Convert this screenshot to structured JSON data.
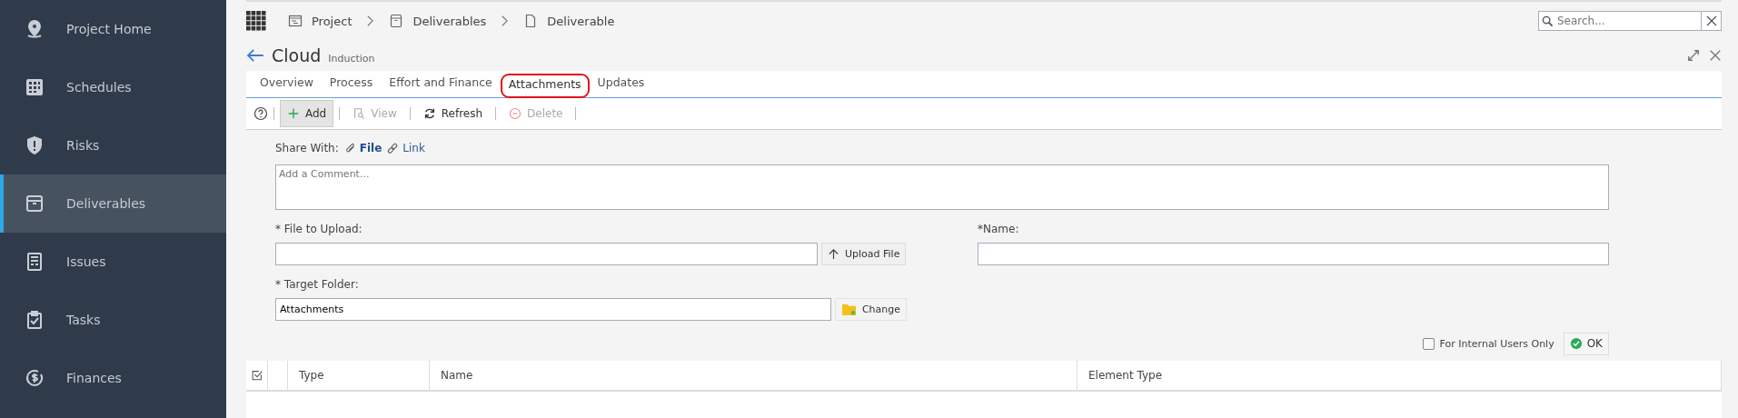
{
  "sidebar": {
    "items": [
      {
        "label": "Project Home",
        "kind": "pin",
        "selected": false
      },
      {
        "label": "Schedules",
        "kind": "grid",
        "selected": false
      },
      {
        "label": "Risks",
        "kind": "shield",
        "selected": false
      },
      {
        "label": "Deliverables",
        "kind": "box",
        "selected": true
      },
      {
        "label": "Issues",
        "kind": "doc",
        "selected": false
      },
      {
        "label": "Tasks",
        "kind": "clipboard",
        "selected": false
      },
      {
        "label": "Finances",
        "kind": "money",
        "selected": false
      }
    ]
  },
  "breadcrumb": [
    {
      "label": "Project",
      "kind": "project"
    },
    {
      "label": "Deliverables",
      "kind": "box"
    },
    {
      "label": "Deliverable",
      "kind": "page"
    }
  ],
  "search": {
    "placeholder": "Search..."
  },
  "header": {
    "title": "Cloud",
    "subtitle": "Induction"
  },
  "tabs": [
    {
      "label": "Overview",
      "selected": false
    },
    {
      "label": "Process",
      "selected": false
    },
    {
      "label": "Effort and Finance",
      "selected": false
    },
    {
      "label": "Attachments",
      "selected": true
    },
    {
      "label": "Updates",
      "selected": false
    }
  ],
  "toolbar": [
    {
      "label": "Add",
      "kind": "plus",
      "disabled": false,
      "pressed": true
    },
    {
      "label": "View",
      "kind": "view",
      "disabled": true,
      "pressed": false
    },
    {
      "label": "Refresh",
      "kind": "refresh",
      "disabled": false,
      "pressed": false
    },
    {
      "label": "Delete",
      "kind": "delete",
      "disabled": true,
      "pressed": false
    }
  ],
  "share": {
    "label": "Share With:",
    "options": [
      {
        "label": "File",
        "kind": "clip",
        "selected": true
      },
      {
        "label": "Link",
        "kind": "link",
        "selected": false
      }
    ]
  },
  "comment": {
    "placeholder": "Add a Comment..."
  },
  "file_upload": {
    "label": "* File to Upload:",
    "button": "Upload File"
  },
  "name_field": {
    "label": "*Name:"
  },
  "target_folder": {
    "label": "* Target Folder:",
    "value": "Attachments",
    "button": "Change"
  },
  "internal_only": {
    "label": "For Internal Users Only",
    "checked": false
  },
  "ok_button": "OK",
  "table": {
    "columns": [
      "Type",
      "Name",
      "Element Type"
    ]
  }
}
